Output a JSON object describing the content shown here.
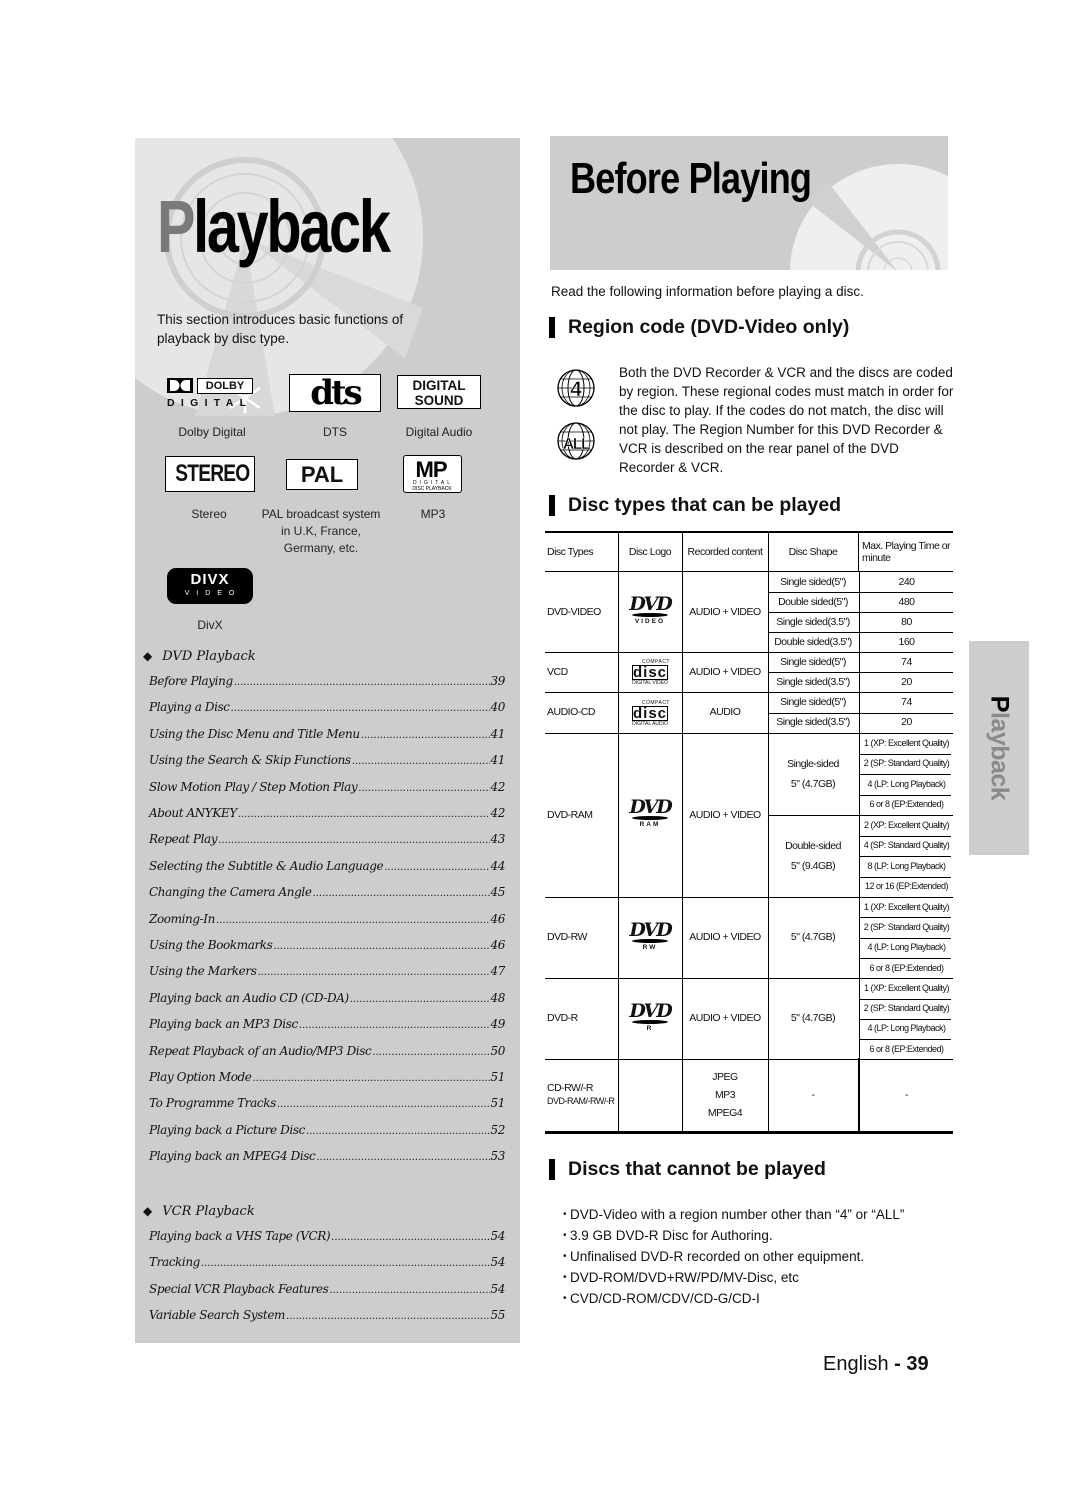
{
  "left_panel": {
    "section_title_first": "P",
    "section_title_rest": "layback",
    "intro": "This section introduces basic functions of playback by disc type.",
    "logos": [
      {
        "icon": "dolby-digital-logo",
        "caption": "Dolby Digital",
        "text_top": "DOLBY",
        "text_bottom": "DIGITAL"
      },
      {
        "icon": "dts-logo",
        "caption": "DTS",
        "text": "dts"
      },
      {
        "icon": "digital-sound-logo",
        "caption": "Digital Audio",
        "text_top": "DIGITAL",
        "text_bottom": "SOUND"
      },
      {
        "icon": "stereo-logo",
        "caption": "Stereo",
        "text": "STEREO"
      },
      {
        "icon": "pal-logo",
        "caption_lines": [
          "PAL broadcast system",
          "in U.K, France,",
          "Germany, etc."
        ],
        "text": "PAL"
      },
      {
        "icon": "mp3-logo",
        "caption": "MP3",
        "text_top": "MP",
        "text_bottom": "DISC PLAYBACK",
        "text_mid": "DIGITAL"
      },
      {
        "icon": "divx-logo",
        "caption": "DivX",
        "text_top": "DIVX",
        "text_bottom": "VIDEO"
      }
    ],
    "toc": {
      "dvd_heading": "DVD Playback",
      "dvd_items": [
        {
          "title": "Before Playing",
          "page": "39"
        },
        {
          "title": "Playing a Disc",
          "page": "40"
        },
        {
          "title": "Using the Disc Menu and Title Menu",
          "page": "41"
        },
        {
          "title": "Using the Search & Skip Functions",
          "page": "41"
        },
        {
          "title": "Slow Motion Play / Step Motion Play",
          "page": "42"
        },
        {
          "title": "About ANYKEY",
          "page": "42"
        },
        {
          "title": "Repeat Play",
          "page": "43"
        },
        {
          "title": "Selecting the Subtitle & Audio Language",
          "page": "44"
        },
        {
          "title": "Changing the Camera Angle",
          "page": "45"
        },
        {
          "title": "Zooming-In",
          "page": "46"
        },
        {
          "title": "Using the Bookmarks",
          "page": "46"
        },
        {
          "title": "Using the Markers",
          "page": "47"
        },
        {
          "title": "Playing back an Audio CD (CD-DA)",
          "page": "48"
        },
        {
          "title": "Playing back an MP3 Disc",
          "page": "49"
        },
        {
          "title": "Repeat Playback of an Audio/MP3 Disc",
          "page": "50"
        },
        {
          "title": "Play Option Mode",
          "page": "51"
        },
        {
          "title": "To Programme Tracks",
          "page": "51"
        },
        {
          "title": "Playing back a Picture Disc",
          "page": "52"
        },
        {
          "title": "Playing back an MPEG4 Disc",
          "page": "53"
        }
      ],
      "vcr_heading": "VCR Playback",
      "vcr_items": [
        {
          "title": "Playing back a VHS Tape (VCR)",
          "page": "54"
        },
        {
          "title": "Tracking",
          "page": "54"
        },
        {
          "title": "Special VCR Playback Features",
          "page": "54"
        },
        {
          "title": "Variable Search System",
          "page": "55"
        }
      ]
    }
  },
  "right": {
    "page_title": "Before Playing",
    "lead": "Read the following information before playing a disc.",
    "region_heading": "Region code (DVD-Video only)",
    "region_icons": [
      "4",
      "ALL"
    ],
    "region_text": "Both the DVD Recorder & VCR and the discs are coded by region. These regional codes must match in order for the disc to play. If the codes do not match, the disc will not play. The Region Number for this DVD Recorder & VCR is described on the rear panel of the DVD Recorder & VCR.",
    "disc_types_heading": "Disc types that can be played",
    "table": {
      "headers": [
        "Disc Types",
        "Disc Logo",
        "Recorded content",
        "Disc Shape",
        "Max. Playing Time or minute"
      ],
      "rows": [
        {
          "type": "DVD-VIDEO",
          "logo": "dvd-video-logo",
          "logo_sub": "VIDEO",
          "content": "AUDIO + VIDEO",
          "shapes": [
            {
              "shape": "Single sided(5\")",
              "times": [
                "240"
              ]
            },
            {
              "shape": "Double sided(5\")",
              "times": [
                "480"
              ]
            },
            {
              "shape": "Single sided(3.5\")",
              "times": [
                "80"
              ]
            },
            {
              "shape": "Double sided(3.5\")",
              "times": [
                "160"
              ]
            }
          ]
        },
        {
          "type": "VCD",
          "logo": "compact-disc-digital-video-logo",
          "logo_sub": "DIGITAL VIDEO",
          "content": "AUDIO + VIDEO",
          "shapes": [
            {
              "shape": "Single sided(5\")",
              "times": [
                "74"
              ]
            },
            {
              "shape": "Single sided(3.5\")",
              "times": [
                "20"
              ]
            }
          ]
        },
        {
          "type": "AUDIO-CD",
          "logo": "compact-disc-digital-audio-logo",
          "logo_sub": "DIGITAL AUDIO",
          "content": "AUDIO",
          "shapes": [
            {
              "shape": "Single sided(5\")",
              "times": [
                "74"
              ]
            },
            {
              "shape": "Single sided(3.5\")",
              "times": [
                "20"
              ]
            }
          ]
        },
        {
          "type": "DVD-RAM",
          "logo": "dvd-ram-logo",
          "logo_sub": "RAM",
          "content": "AUDIO + VIDEO",
          "shapes": [
            {
              "shape": "Single-sided 5\" (4.7GB)",
              "times": [
                "1 (XP: Excellent Quality)",
                "2 (SP: Standard Quality)",
                "4 (LP: Long Playback)",
                "6 or 8 (EP:Extended)"
              ]
            },
            {
              "shape": "Double-sided 5\" (9.4GB)",
              "times": [
                "2 (XP: Excellent Quality)",
                "4 (SP: Standard Quality)",
                "8 (LP: Long Playback)",
                "12 or 16 (EP:Extended)"
              ]
            }
          ]
        },
        {
          "type": "DVD-RW",
          "logo": "dvd-rw-logo",
          "logo_sub": "RW",
          "content": "AUDIO + VIDEO",
          "shapes": [
            {
              "shape": "5\" (4.7GB)",
              "times": [
                "1 (XP: Excellent Quality)",
                "2 (SP: Standard Quality)",
                "4 (LP: Long Playback)",
                "6 or 8 (EP:Extended)"
              ]
            }
          ]
        },
        {
          "type": "DVD-R",
          "logo": "dvd-r-logo",
          "logo_sub": "R",
          "content": "AUDIO + VIDEO",
          "shapes": [
            {
              "shape": "5\" (4.7GB)",
              "times": [
                "1 (XP: Excellent Quality)",
                "2 (SP: Standard Quality)",
                "4 (LP: Long Playback)",
                "6 or 8 (EP:Extended)"
              ]
            }
          ]
        },
        {
          "type": "CD-RW/-R",
          "type_sub": "DVD-RAM/-RW/-R",
          "logo": "",
          "content": "JPEG\nMP3\nMPEG4",
          "shapes": [
            {
              "shape": "-",
              "times": [
                "-"
              ]
            }
          ]
        }
      ]
    },
    "cannot_heading": "Discs that cannot be played",
    "cannot_items": [
      "DVD-Video with a region number other than “4” or “ALL”",
      "3.9 GB DVD-R Disc for Authoring.",
      "Unfinalised DVD-R recorded on other equipment.",
      "DVD-ROM/DVD+RW/PD/MV-Disc, etc",
      "CVD/CD-ROM/CDV/CD-G/CD-I"
    ],
    "footer_language": "English",
    "footer_sep": " - ",
    "footer_page": "39"
  },
  "side_tab": {
    "label_first": "P",
    "label_rest": "layback"
  },
  "colors": {
    "panel_gray": "#cdcdcd",
    "text": "#111111",
    "title_gray": "#7a7a7a"
  }
}
